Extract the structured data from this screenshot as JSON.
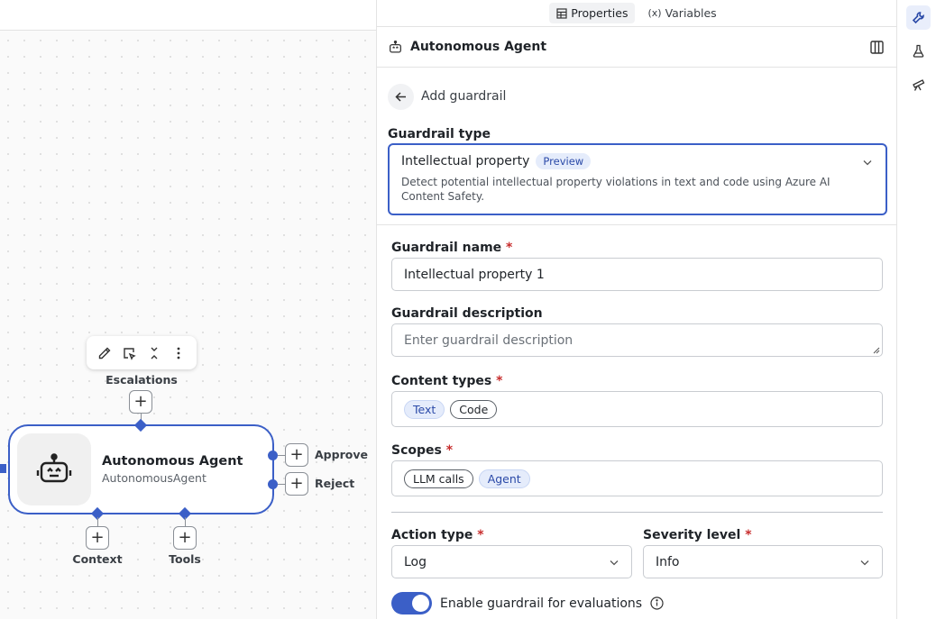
{
  "panel": {
    "tabs": [
      {
        "label": "Properties",
        "icon": "table-icon",
        "active": true
      },
      {
        "label": "Variables",
        "icon": "variable-icon",
        "active": false
      }
    ],
    "title": "Autonomous Agent",
    "back_label": "Add guardrail",
    "guardrail_type": {
      "label": "Guardrail type",
      "selected": "Intellectual property",
      "badge": "Preview",
      "description": "Detect potential intellectual property violations in text and code using Azure AI Content Safety."
    },
    "guardrail_name": {
      "label": "Guardrail name",
      "required": "*",
      "value": "Intellectual property 1"
    },
    "guardrail_description": {
      "label": "Guardrail description",
      "placeholder": "Enter guardrail description"
    },
    "content_types": {
      "label": "Content types",
      "required": "*",
      "chips": [
        {
          "label": "Text",
          "selected": true
        },
        {
          "label": "Code",
          "selected": false
        }
      ]
    },
    "scopes": {
      "label": "Scopes",
      "required": "*",
      "chips": [
        {
          "label": "LLM calls",
          "selected": false
        },
        {
          "label": "Agent",
          "selected": true
        }
      ]
    },
    "action_type": {
      "label": "Action type",
      "required": "*",
      "value": "Log"
    },
    "severity_level": {
      "label": "Severity level",
      "required": "*",
      "value": "Info"
    },
    "enable_eval": {
      "label": "Enable guardrail for evaluations",
      "on": true
    }
  },
  "canvas": {
    "node": {
      "title": "Autonomous Agent",
      "subtitle": "AutonomousAgent"
    },
    "handles": {
      "escalations": "Escalations",
      "approve": "Approve",
      "reject": "Reject",
      "context": "Context",
      "tools": "Tools"
    }
  },
  "colors": {
    "accent": "#3b5fc7",
    "badge_bg": "#e5ecfb",
    "required": "#c72c2c"
  }
}
